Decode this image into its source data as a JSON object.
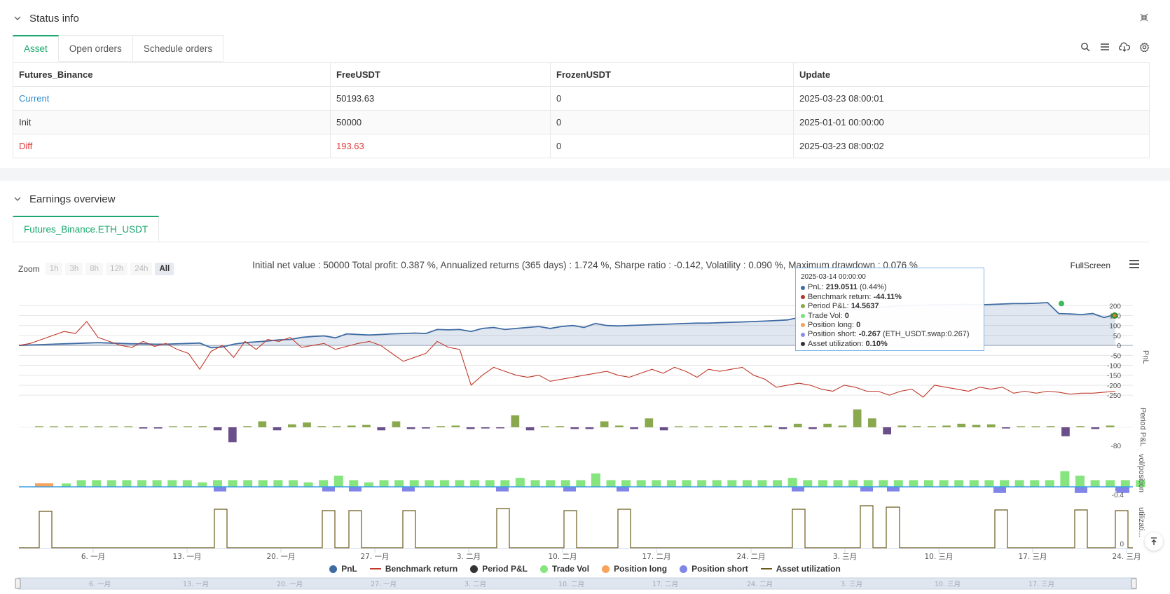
{
  "status_panel": {
    "title": "Status info",
    "tabs": [
      {
        "label": "Asset",
        "active": true
      },
      {
        "label": "Open orders",
        "active": false
      },
      {
        "label": "Schedule orders",
        "active": false
      }
    ],
    "toolbar_icons": [
      "search-icon",
      "list-icon",
      "cloud-download-icon",
      "gear-icon"
    ],
    "table": {
      "headers": [
        "Futures_Binance",
        "FreeUSDT",
        "FrozenUSDT",
        "Update"
      ],
      "rows": [
        [
          "Current",
          "50193.63",
          "0",
          "2025-03-23 08:00:01"
        ],
        [
          "Init",
          "50000",
          "0",
          "2025-01-01 00:00:00"
        ],
        [
          "Diff",
          "193.63",
          "0",
          "2025-03-23 08:00:02"
        ]
      ]
    }
  },
  "earnings_panel": {
    "title": "Earnings overview",
    "tab": "Futures_Binance.ETH_USDT",
    "summary": "Initial net value : 50000 Total profit: 0.387 %, Annualized returns (365 days) : 1.724 %, Sharpe ratio : -0.142, Volatility : 0.090 %, Maximum drawdown : 0.076 %",
    "fullscreen_label": "FullScreen",
    "zoom": {
      "label": "Zoom",
      "buttons": [
        "1h",
        "3h",
        "8h",
        "12h",
        "24h",
        "All"
      ],
      "active": "All"
    },
    "tooltip": {
      "date": "2025-03-14 00:00:00",
      "rows": [
        {
          "label": "PnL:",
          "value": "219.0511",
          "extra": "(0.44%)",
          "color": "#3f6ba3"
        },
        {
          "label": "Benchmark return:",
          "value": "-44.11%",
          "extra": "",
          "color": "#b03a2e"
        },
        {
          "label": "Period P&L:",
          "value": "14.5637",
          "extra": "",
          "color": "#8aa84e"
        },
        {
          "label": "Trade Vol:",
          "value": "0",
          "extra": "",
          "color": "#7ee07a"
        },
        {
          "label": "Position long:",
          "value": "0",
          "extra": "",
          "color": "#f5a25d"
        },
        {
          "label": "Position short:",
          "value": "-0.267",
          "extra": "(ETH_USDT.swap:0.267)",
          "color": "#8a8ee8"
        },
        {
          "label": "Asset utilization:",
          "value": "0.10%",
          "extra": "",
          "color": "#333333"
        }
      ]
    },
    "legend": [
      {
        "label": "PnL",
        "color": "#3f6ba3",
        "kind": "dot"
      },
      {
        "label": "Benchmark return",
        "color": "#c0392b",
        "kind": "line"
      },
      {
        "label": "Period P&L",
        "color": "#333333",
        "kind": "dot"
      },
      {
        "label": "Trade Vol",
        "color": "#86e57f",
        "kind": "dot"
      },
      {
        "label": "Position long",
        "color": "#f7a35c",
        "kind": "dot"
      },
      {
        "label": "Position short",
        "color": "#8085e9",
        "kind": "dot"
      },
      {
        "label": "Asset utilization",
        "color": "#6b5a1a",
        "kind": "line"
      }
    ]
  },
  "chart_data": {
    "type": "line",
    "x_tick_labels": [
      "6. 一月",
      "13. 一月",
      "20. 一月",
      "27. 一月",
      "3. 二月",
      "10. 二月",
      "17. 二月",
      "24. 二月",
      "3. 三月",
      "10. 三月",
      "17. 三月",
      "24. 三月"
    ],
    "panes": [
      {
        "ylabel": "PnL",
        "y_tick_labels": [
          "200",
          "150",
          "100",
          "50",
          "0",
          "-50",
          "-100",
          "-150",
          "-200",
          "-250"
        ],
        "ylim": [
          -260,
          215
        ]
      },
      {
        "ylabel": "Period P&L",
        "y_tick_labels": [
          "-80"
        ]
      },
      {
        "ylabel": "vol/position",
        "y_tick_labels": [
          "-0.4"
        ]
      },
      {
        "ylabel": "utilizati...",
        "y_tick_labels": [
          "0"
        ]
      }
    ],
    "navigator_labels": [
      "6. 一月",
      "13. 一月",
      "20. 一月",
      "27. 一月",
      "3. 二月",
      "10. 二月",
      "17. 二月",
      "24. 二月",
      "3. 三月",
      "10. 三月",
      "17. 三月"
    ],
    "series": [
      {
        "name": "PnL",
        "values": [
          0,
          2,
          4,
          6,
          8,
          10,
          12,
          14,
          12,
          10,
          8,
          8,
          6,
          6,
          8,
          10,
          12,
          -12,
          -8,
          6,
          14,
          18,
          22,
          28,
          30,
          40,
          45,
          48,
          38,
          58,
          55,
          52,
          55,
          58,
          60,
          62,
          60,
          80,
          78,
          80,
          70,
          85,
          90,
          80,
          85,
          90,
          95,
          85,
          95,
          100,
          90,
          110,
          100,
          98,
          100,
          102,
          104,
          106,
          108,
          110,
          112,
          112,
          114,
          116,
          118,
          120,
          122,
          125,
          128,
          140,
          150,
          160,
          170,
          175,
          180,
          185,
          190,
          195,
          200,
          200,
          202,
          204,
          204,
          206,
          206,
          204,
          206,
          208,
          210,
          210,
          212,
          215,
          160,
          158,
          155,
          160,
          140,
          155
        ]
      },
      {
        "name": "Benchmark return",
        "values": [
          0,
          10,
          30,
          50,
          70,
          60,
          120,
          40,
          20,
          0,
          -10,
          20,
          -5,
          10,
          -20,
          -40,
          -120,
          -30,
          0,
          -60,
          20,
          -20,
          30,
          20,
          40,
          -10,
          0,
          10,
          -20,
          -5,
          10,
          20,
          0,
          -40,
          -80,
          -60,
          -40,
          20,
          -10,
          -20,
          -200,
          -150,
          -110,
          -130,
          -150,
          -160,
          -150,
          -180,
          -170,
          -160,
          -150,
          -140,
          -130,
          -150,
          -160,
          -140,
          -120,
          -140,
          -110,
          -130,
          -160,
          -120,
          -130,
          -120,
          -110,
          -150,
          -170,
          -210,
          -200,
          -190,
          -200,
          -220,
          -230,
          -200,
          -210,
          -230,
          -230,
          -250,
          -230,
          -220,
          -260,
          -200,
          -210,
          -220,
          -230,
          -210,
          -220,
          -210,
          -240,
          -230,
          -240,
          -230,
          -235,
          -245,
          -240,
          -240,
          -235,
          -230
        ]
      },
      {
        "name": "Period P&L",
        "values": [
          0,
          0,
          0,
          0,
          0,
          0,
          0,
          -2,
          -2,
          0,
          0,
          2,
          -5,
          -25,
          2,
          10,
          -5,
          5,
          8,
          2,
          2,
          3,
          4,
          -5,
          10,
          -3,
          -2,
          2,
          3,
          -3,
          -2,
          -1,
          20,
          -5,
          2,
          2,
          -3,
          -3,
          10,
          3,
          -3,
          15,
          -5,
          0,
          0,
          1,
          2,
          2,
          2,
          3,
          -3,
          6,
          -3,
          6,
          3,
          30,
          15,
          -12,
          3,
          2,
          2,
          3,
          6,
          4,
          5,
          -2,
          0,
          0,
          2,
          -15,
          2,
          -3,
          3
        ]
      },
      {
        "name": "Trade Vol",
        "values": [
          0.3,
          0.6,
          0.6,
          0.6,
          0.6,
          0.6,
          0.6,
          0.6,
          0.6,
          0.4,
          0.6,
          0.6,
          0.6,
          0.6,
          0.6,
          0.6,
          0.4,
          0.6,
          1.0,
          0.6,
          0.4,
          0.6,
          0.6,
          0.6,
          0.6,
          0.6,
          0.6,
          0.6,
          0.6,
          0.6,
          0.8,
          0.6,
          0.6,
          0.6,
          0.6,
          1.2,
          0.6,
          0.6,
          0.6,
          0.6,
          0.6,
          0.6,
          0.6,
          0.6,
          0.6,
          0.6,
          0.6,
          0.6,
          0.8,
          0.6,
          0.6,
          0.6,
          0.6,
          0.6,
          0.6,
          0.6,
          0.6,
          0.6,
          0.6,
          0.6,
          0.6,
          0.6,
          0.6,
          0.6,
          0.6,
          0.6,
          1.4,
          1.0,
          0.6,
          0.6,
          0.6,
          0.6
        ]
      },
      {
        "name": "Position short",
        "values": [
          -0.3,
          -0.3,
          -0.3,
          -0.3,
          -0.3,
          -0.3,
          -0.3,
          -0.3,
          -0.3,
          -0.3,
          -0.4,
          -0.4,
          -0.3,
          -0.4
        ]
      },
      {
        "name": "Asset utilization",
        "values": [
          1,
          1,
          1,
          1,
          1,
          1,
          1,
          1,
          1,
          1,
          1,
          1,
          1,
          1,
          1,
          1,
          1,
          1
        ]
      }
    ]
  }
}
